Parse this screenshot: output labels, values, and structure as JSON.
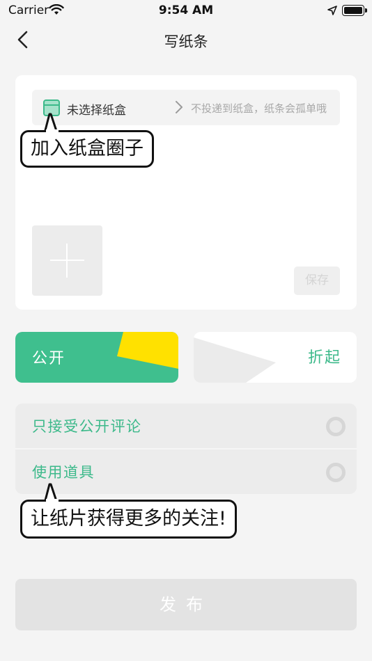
{
  "status_bar": {
    "carrier": "Carrier",
    "time": "9:54 AM"
  },
  "nav": {
    "title": "写纸条"
  },
  "editor": {
    "box_select_label": "未选择纸盒",
    "box_select_hint": "不投递到纸盒，纸条会孤单哦",
    "save_label": "保存"
  },
  "tooltips": {
    "box_tip": "加入纸盒圈子",
    "props_tip": "让纸片获得更多的关注!"
  },
  "visibility": {
    "public_label": "公开",
    "fold_label": "折起",
    "accent_color": "#3fbf8e",
    "highlight_color": "#ffe100"
  },
  "options": [
    {
      "label": "只接受公开评论",
      "checked": false
    },
    {
      "label": "使用道具",
      "checked": false
    }
  ],
  "publish_label": "发布"
}
